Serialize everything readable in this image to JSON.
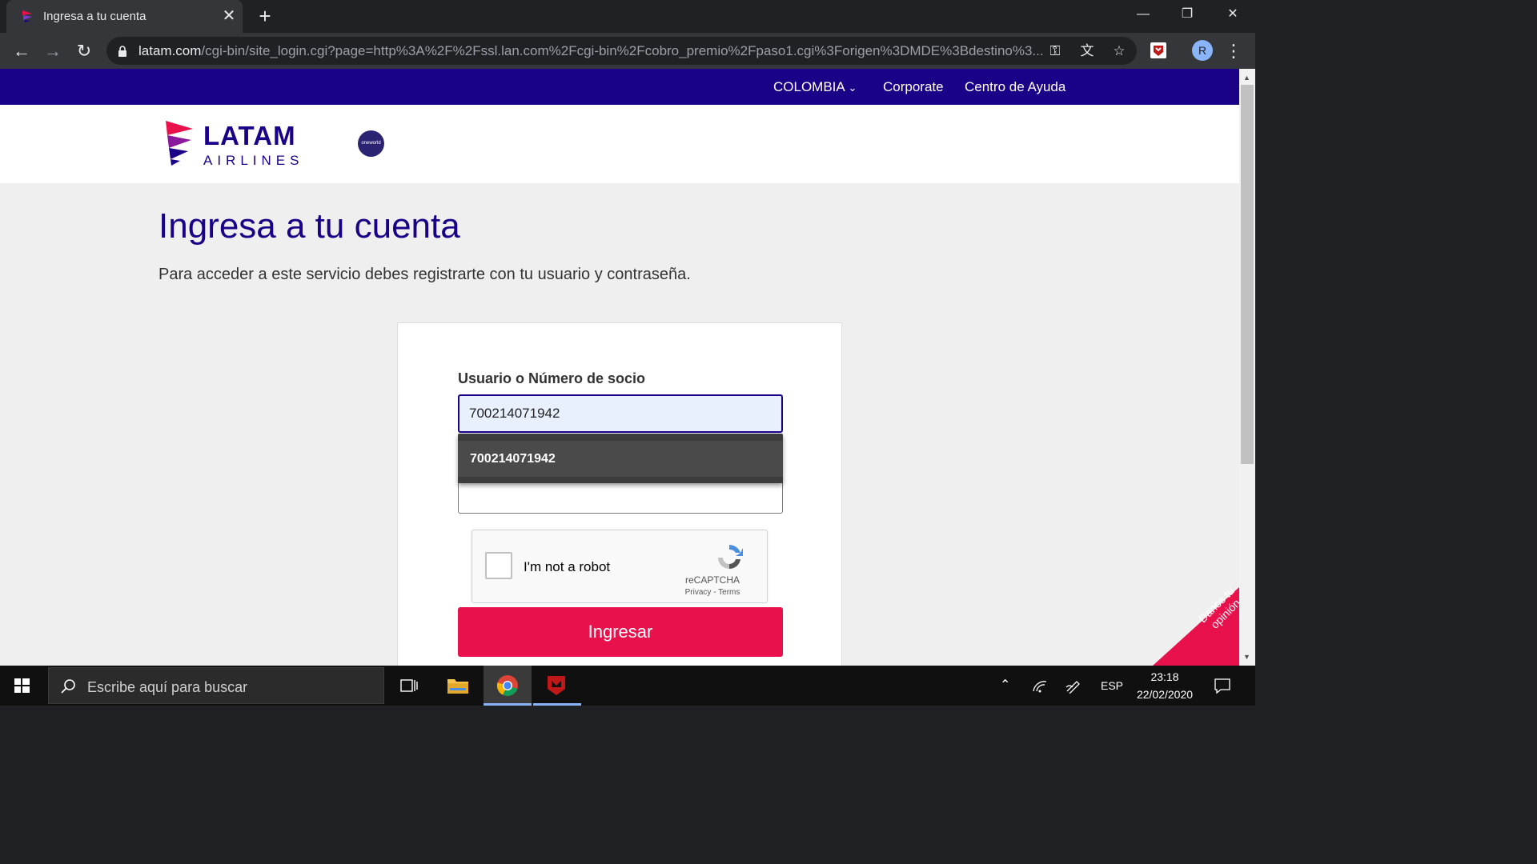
{
  "browser": {
    "tab_title": "Ingresa a tu cuenta",
    "url_host": "latam.com",
    "url_path": "/cgi-bin/site_login.cgi?page=http%3A%2F%2Fssl.lan.com%2Fcgi-bin%2Fcobro_premio%2Fpaso1.cgi%3Forigen%3DMDE%3Bdestino%3...",
    "profile_initial": "R"
  },
  "site": {
    "topnav": {
      "country": "COLOMBIA",
      "corporate": "Corporate",
      "help": "Centro de Ayuda"
    },
    "logo_line1": "LATAM",
    "logo_line2": "AIRLINES",
    "oneworld": "oneworld",
    "title": "Ingresa a tu cuenta",
    "subtitle": "Para acceder a este servicio debes registrarte con tu usuario y contraseña.",
    "form": {
      "user_label": "Usuario o Número de socio",
      "user_value": "700214071942",
      "autocomplete_option": "700214071942",
      "password_value": "",
      "recaptcha_label": "I'm not a robot",
      "recaptcha_brand": "reCAPTCHA",
      "recaptcha_links": "Privacy - Terms",
      "submit_label": "Ingresar"
    },
    "feedback_label": "Danos tu opinión",
    "colors": {
      "brand_navy": "#1b0088",
      "brand_red": "#e8114b"
    }
  },
  "taskbar": {
    "search_placeholder": "Escribe aquí para buscar",
    "language": "ESP",
    "time": "23:18",
    "date": "22/02/2020"
  }
}
